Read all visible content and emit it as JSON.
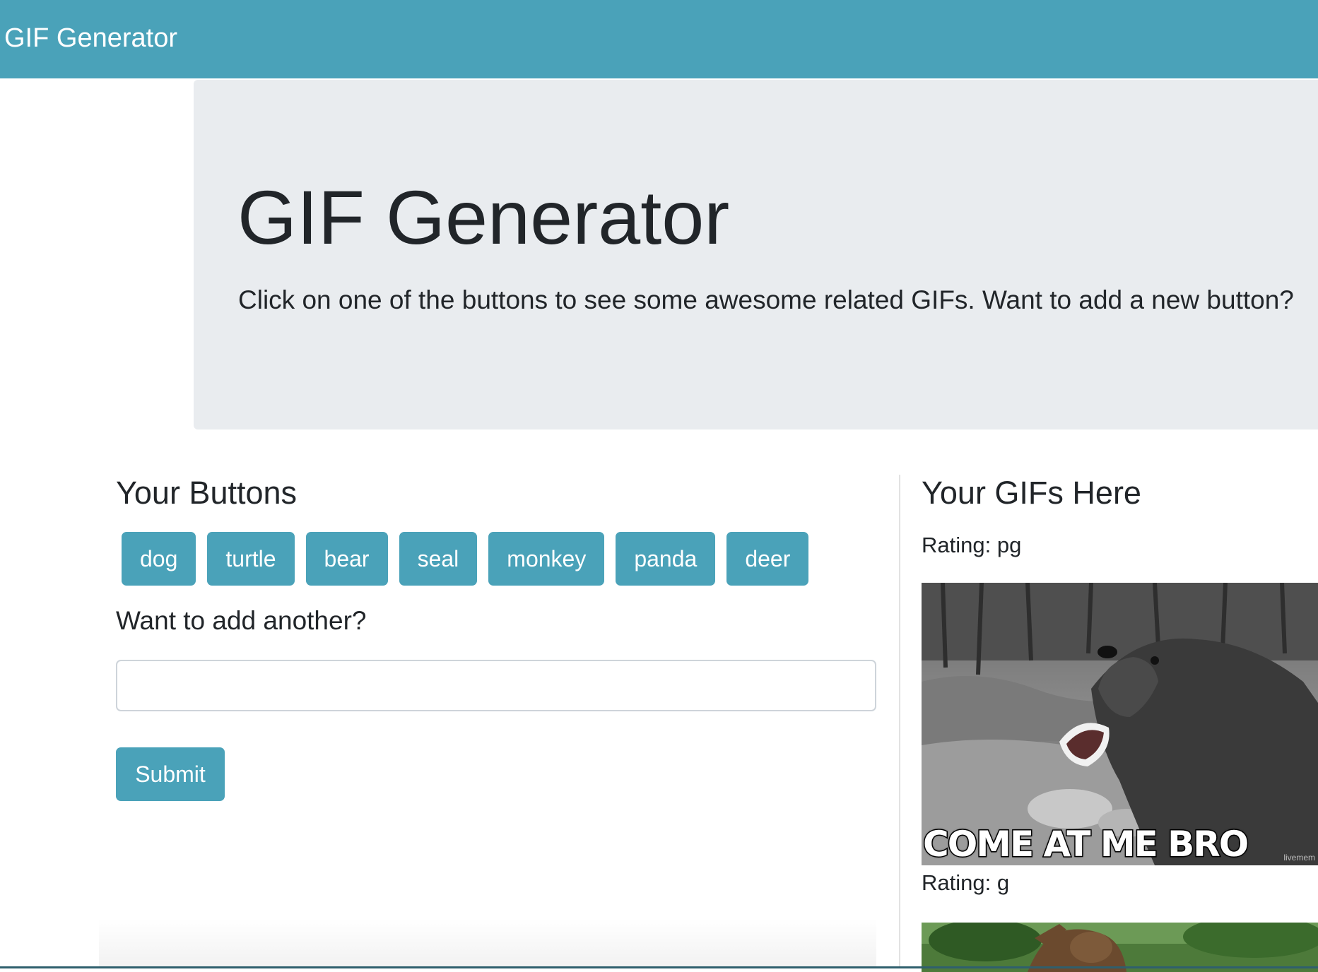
{
  "navbar": {
    "brand": "GIF Generator"
  },
  "jumbotron": {
    "title": "GIF Generator",
    "lead": "Click on one of the buttons to see some awesome related GIFs. Want to add a new button?"
  },
  "buttons_section": {
    "title": "Your Buttons",
    "topics": [
      "dog",
      "turtle",
      "bear",
      "seal",
      "monkey",
      "panda",
      "deer"
    ],
    "add_title": "Want to add another?",
    "input_value": "",
    "input_placeholder": "",
    "submit_label": "Submit"
  },
  "gifs_section": {
    "title": "Your GIFs Here",
    "gifs": [
      {
        "rating": "Rating: pg",
        "caption": "COME AT ME BRO",
        "watermark": "livemem"
      },
      {
        "rating": "Rating: g"
      }
    ]
  },
  "colors": {
    "primary": "#4aa2b9",
    "jumbotron_bg": "#e9ecef",
    "text": "#212529"
  }
}
